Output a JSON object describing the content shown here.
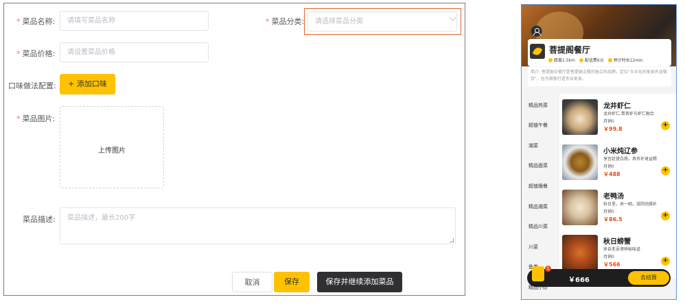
{
  "form": {
    "name_label": "菜品名称:",
    "name_placeholder": "请填写菜品名称",
    "category_label": "菜品分类:",
    "category_placeholder": "请选择菜品分类",
    "price_label": "菜品价格:",
    "price_placeholder": "请设置菜品价格",
    "flavor_label": "口味做法配置:",
    "add_flavor_button": "+ 添加口味",
    "image_label": "菜品图片:",
    "upload_text": "上传图片",
    "desc_label": "菜品描述:",
    "desc_placeholder": "菜品描述，最长200字",
    "cancel_button": "取消",
    "save_button": "保存",
    "save_continue_button": "保存并继续添加菜品",
    "required_mark": "*",
    "accent_color": "#ffc200",
    "focus_color": "#e0642a"
  },
  "phone": {
    "shop_name": "菩提阁餐厅",
    "distance": "距离1.5km",
    "delivery_fee": "配送费6元",
    "delivery_time": "预计时长12min",
    "intro": "简介: 菩提阁中餐厅是菩提阁点餐的独立的品牌，定位\"大众化的美食外送餐饮\"，旨为顾客打造专业美食。",
    "categories": [
      "精品热菜",
      "超值午餐",
      "湘菜",
      "精品面菜",
      "超值晚餐",
      "精品湘菜",
      "精品川菜",
      "川菜",
      "鱼类",
      "精品小炒"
    ],
    "dishes": [
      {
        "name": "龙井虾仁",
        "desc": "龙井虾仁,青茶虾与虾仁融合",
        "sales": "月销0",
        "price": "￥99.8"
      },
      {
        "name": "小米炖辽参",
        "desc": "享宫廷营白质。具有补肾益精",
        "sales": "月销0",
        "price": "￥488"
      },
      {
        "name": "老鸭汤",
        "desc": "秋日里，来一碗。滋阴润燥补",
        "sales": "月销0",
        "price": "￥86.5"
      },
      {
        "name": "秋日螃蟹",
        "desc": "来自老吾港神秘味道",
        "sales": "月销0",
        "price": "￥566"
      }
    ],
    "cart_total": "￥666",
    "cart_count": "1",
    "checkout_button": "去结算"
  }
}
